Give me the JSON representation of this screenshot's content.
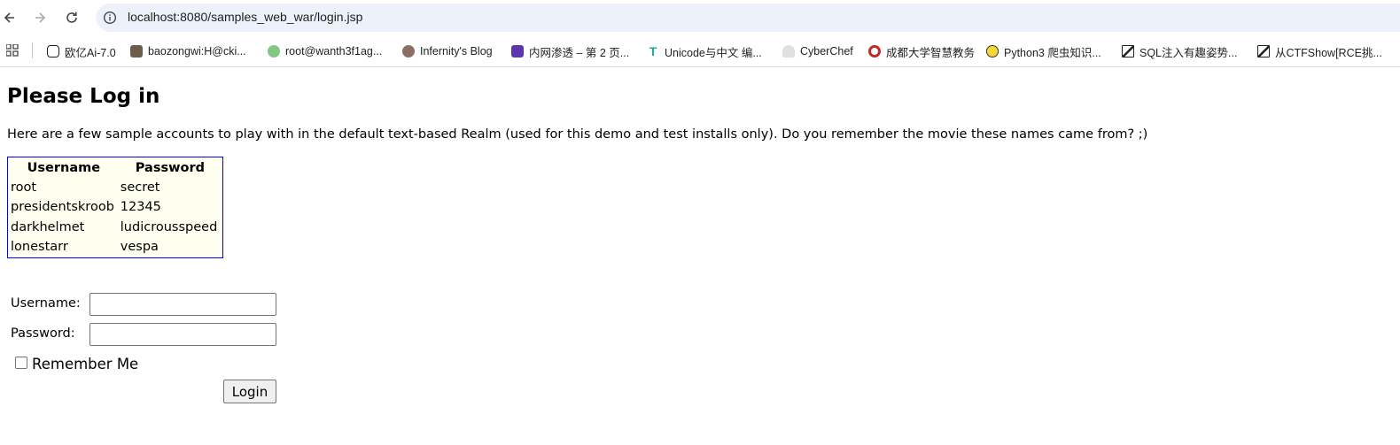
{
  "browser": {
    "url": "localhost:8080/samples_web_war/login.jsp",
    "bookmarks": [
      {
        "label": "欧亿Ai-7.0",
        "icon": "bot-icon",
        "color": "#202124"
      },
      {
        "label": "baozongwi:H@cki...",
        "icon": "avatar-icon",
        "color": "#6d5c4a"
      },
      {
        "label": "root@wanth3f1ag...",
        "icon": "plant-icon",
        "color": "#4caf50"
      },
      {
        "label": "Infernity's Blog",
        "icon": "avatar-icon",
        "color": "#8d6e63"
      },
      {
        "label": "内网渗透 – 第 2 页...",
        "icon": "game-icon",
        "color": "#5e35b1"
      },
      {
        "label": "Unicode与中文 编...",
        "icon": "t-icon",
        "color": "#26a69a"
      },
      {
        "label": "CyberChef",
        "icon": "chef-hat-icon",
        "color": "#bdbdbd"
      },
      {
        "label": "成都大学智慧教务",
        "icon": "school-icon",
        "color": "#c62828"
      },
      {
        "label": "Python3 爬虫知识...",
        "icon": "biohazard-icon",
        "color": "#fdd835"
      },
      {
        "label": "SQL注入有趣姿势...",
        "icon": "slash-icon",
        "color": "#212121"
      },
      {
        "label": "从CTFShow[RCE挑...",
        "icon": "slash-icon",
        "color": "#212121"
      }
    ]
  },
  "page": {
    "title": "Please Log in",
    "intro": "Here are a few sample accounts to play with in the default text-based Realm (used for this demo and test installs only). Do you remember the movie these names came from? ;)",
    "table": {
      "headers": [
        "Username",
        "Password"
      ],
      "rows": [
        [
          "root",
          "secret"
        ],
        [
          "presidentskroob",
          "12345"
        ],
        [
          "darkhelmet",
          "ludicrousspeed"
        ],
        [
          "lonestarr",
          "vespa"
        ]
      ]
    },
    "form": {
      "username_label": "Username:",
      "password_label": "Password:",
      "username_value": "",
      "password_value": "",
      "remember_label": "Remember Me",
      "remember_checked": false,
      "login_label": "Login"
    }
  }
}
